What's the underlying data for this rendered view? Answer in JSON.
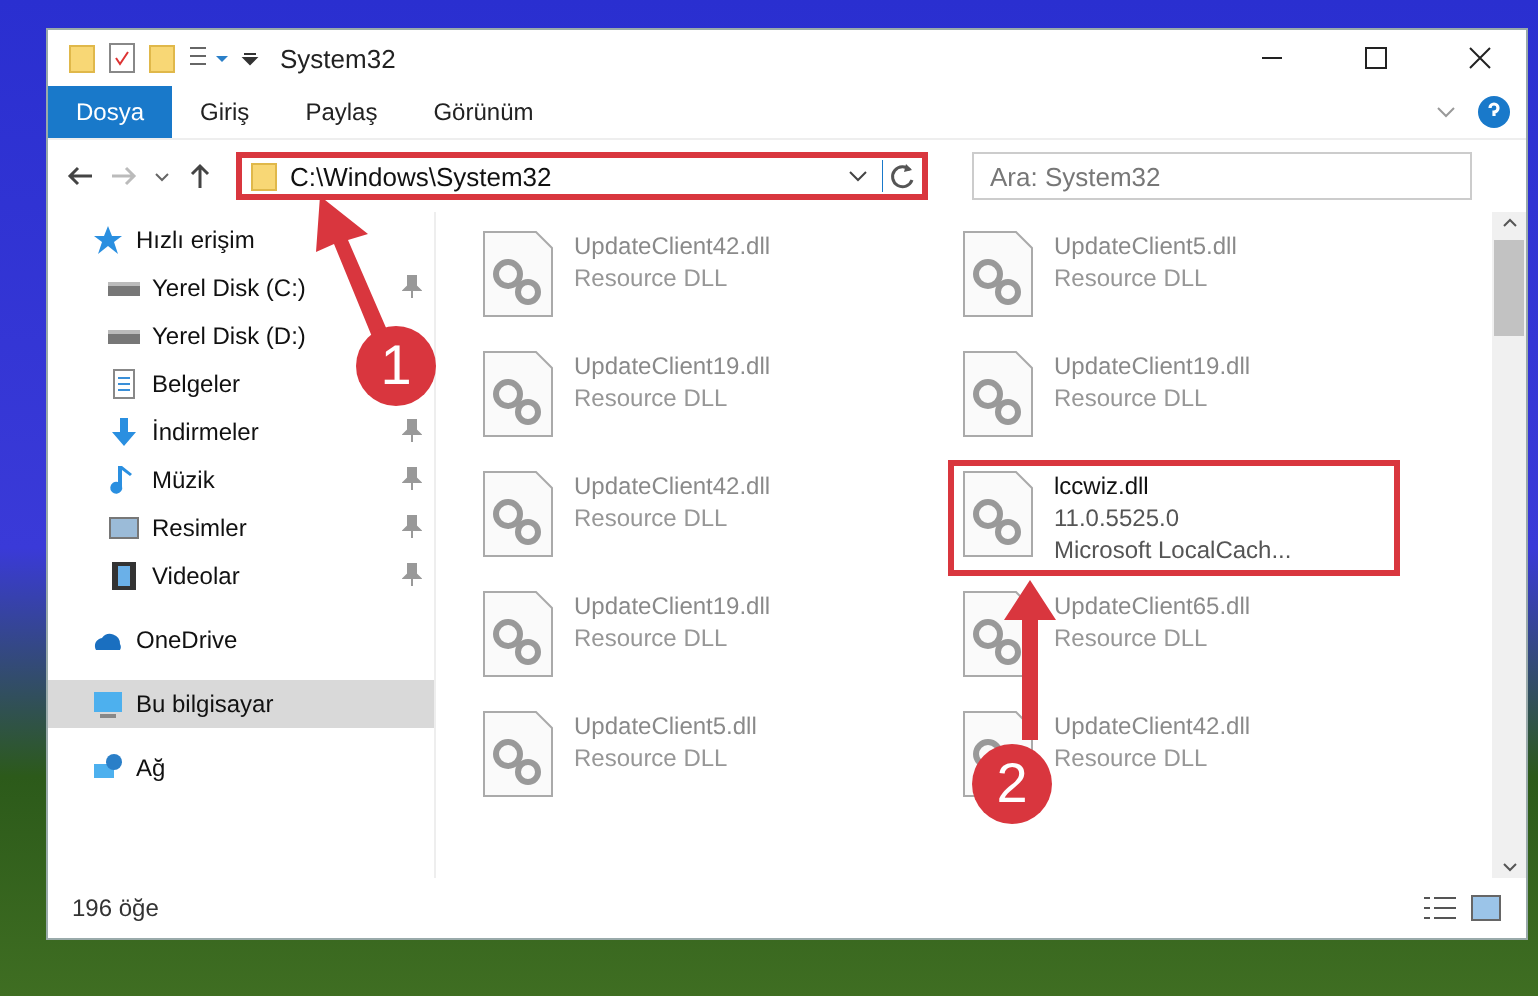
{
  "window": {
    "title": "System32"
  },
  "ribbon_tabs": [
    {
      "label": "Dosya",
      "selected": true
    },
    {
      "label": "Giriş",
      "selected": false
    },
    {
      "label": "Paylaş",
      "selected": false
    },
    {
      "label": "Görünüm",
      "selected": false
    }
  ],
  "address": {
    "path": "C:\\Windows\\System32",
    "highlighted": true
  },
  "search": {
    "placeholder": "Ara: System32"
  },
  "sidebar": {
    "items": [
      {
        "label": "Hızlı erişim",
        "selected": false,
        "children": [
          {
            "label": "Yerel Disk (C:)",
            "pinned": true
          },
          {
            "label": "Yerel Disk (D:)",
            "pinned": false
          },
          {
            "label": "Belgeler",
            "pinned": false
          },
          {
            "label": "İndirmeler",
            "pinned": true
          },
          {
            "label": "Müzik",
            "pinned": true
          },
          {
            "label": "Resimler",
            "pinned": true
          },
          {
            "label": "Videolar",
            "pinned": true
          }
        ]
      },
      {
        "label": "OneDrive",
        "selected": false
      },
      {
        "label": "Bu bilgisayar",
        "selected": true
      },
      {
        "label": "Ağ",
        "selected": false
      }
    ]
  },
  "files": [
    {
      "name": "UpdateClient42.dll",
      "lines": [
        "Resource DLL"
      ],
      "dimmed": true,
      "highlighted": false
    },
    {
      "name": "UpdateClient5.dll",
      "lines": [
        "Resource DLL"
      ],
      "dimmed": true,
      "highlighted": false
    },
    {
      "name": "UpdateClient19.dll",
      "lines": [
        "Resource DLL"
      ],
      "dimmed": true,
      "highlighted": false
    },
    {
      "name": "UpdateClient19.dll",
      "lines": [
        "Resource DLL"
      ],
      "dimmed": true,
      "highlighted": false
    },
    {
      "name": "UpdateClient42.dll",
      "lines": [
        "Resource DLL"
      ],
      "dimmed": true,
      "highlighted": false
    },
    {
      "name": "lccwiz.dll",
      "lines": [
        "11.0.5525.0",
        "Microsoft LocalCach..."
      ],
      "dimmed": false,
      "highlighted": true
    },
    {
      "name": "UpdateClient19.dll",
      "lines": [
        "Resource DLL"
      ],
      "dimmed": true,
      "highlighted": false
    },
    {
      "name": "UpdateClient65.dll",
      "lines": [
        "Resource DLL"
      ],
      "dimmed": true,
      "highlighted": false
    },
    {
      "name": "UpdateClient5.dll",
      "lines": [
        "Resource DLL"
      ],
      "dimmed": true,
      "highlighted": false
    },
    {
      "name": "UpdateClient42.dll",
      "lines": [
        "Resource DLL"
      ],
      "dimmed": true,
      "highlighted": false
    }
  ],
  "status_bar": {
    "count": "196 öğe"
  },
  "annotations": [
    {
      "label": "1"
    },
    {
      "label": "2"
    }
  ]
}
